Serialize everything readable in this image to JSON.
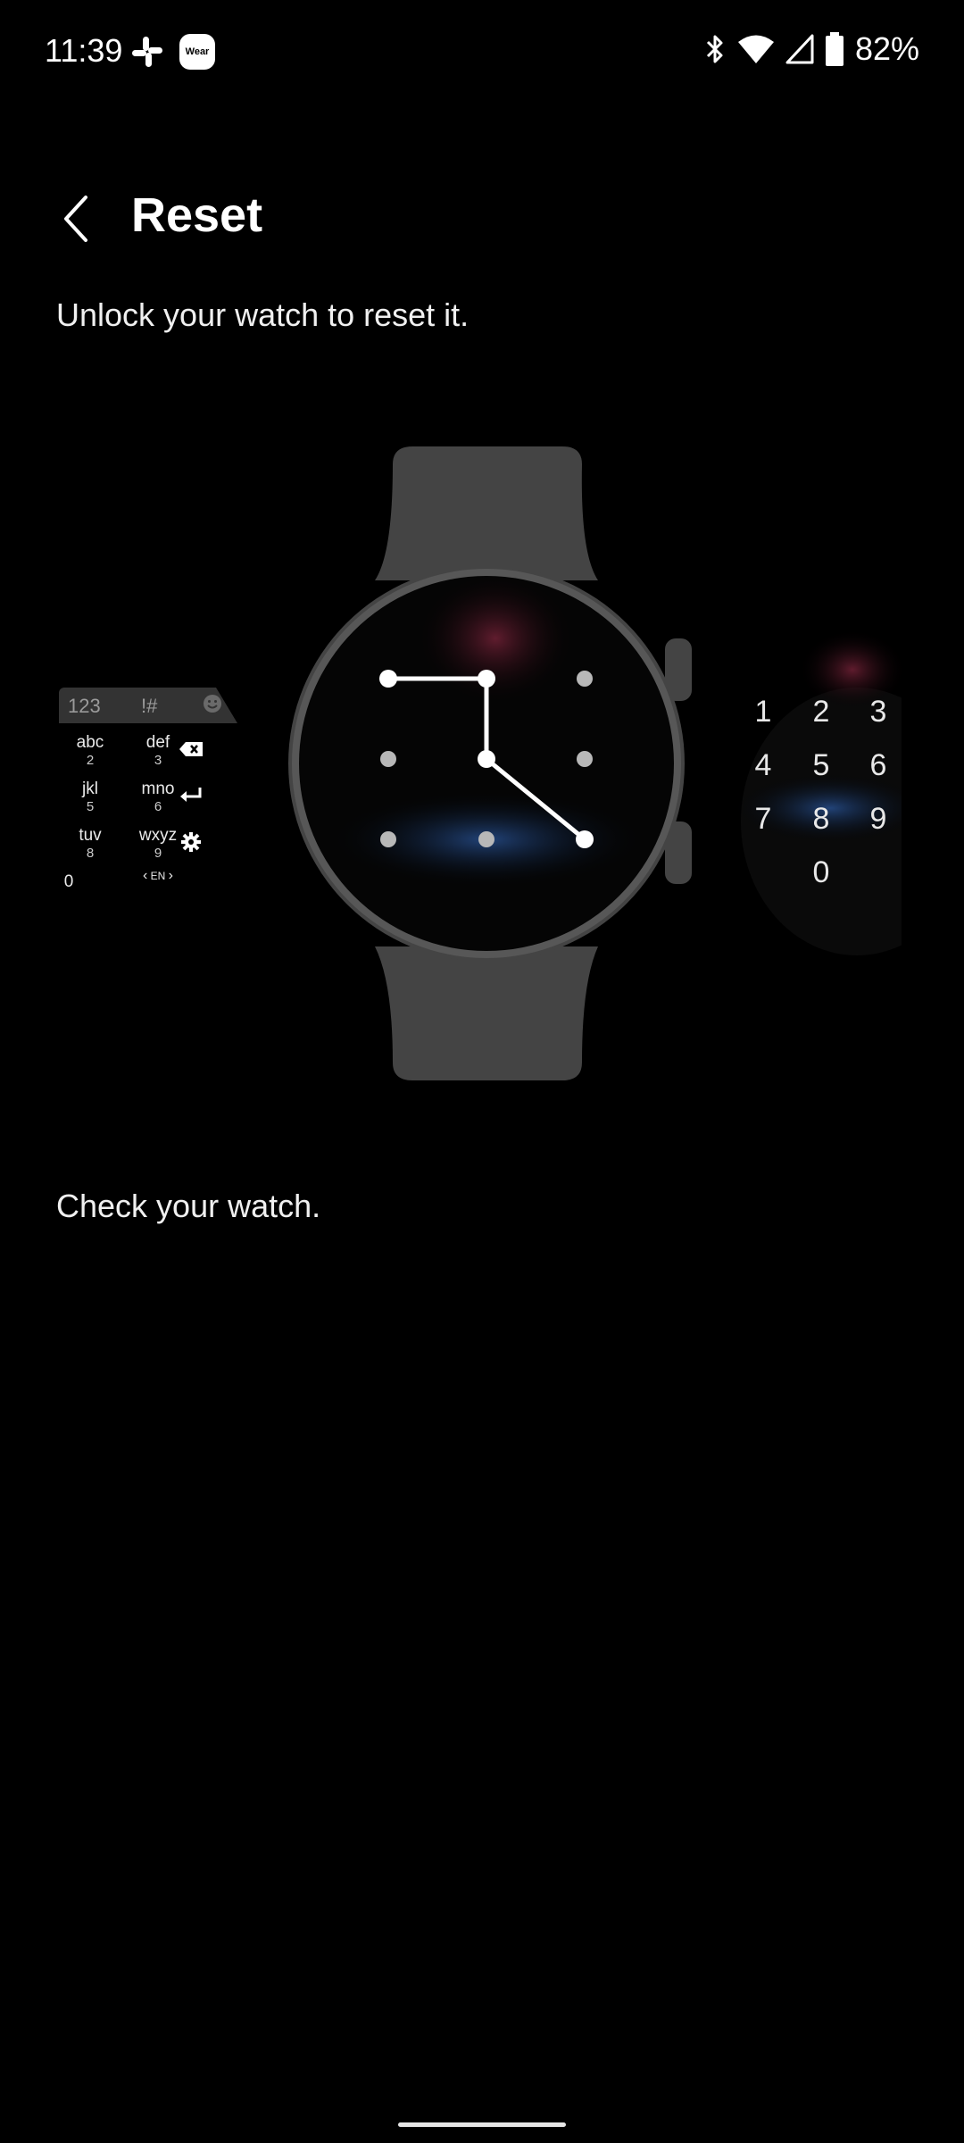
{
  "status_bar": {
    "time": "11:39",
    "wear_badge": "Wear",
    "battery": "82%",
    "icons": [
      "slack-icon",
      "wear-app-icon",
      "bluetooth-icon",
      "wifi-icon",
      "signal-icon",
      "battery-icon"
    ]
  },
  "header": {
    "title": "Reset",
    "back_icon": "chevron-left-icon"
  },
  "subtitle": "Unlock your watch to reset it.",
  "footer_text": "Check your watch.",
  "keyboard": {
    "top_keys": [
      "123",
      "!#"
    ],
    "keys": [
      {
        "letters": "abc",
        "num": "2"
      },
      {
        "letters": "def",
        "num": "3"
      },
      {
        "letters": "jkl",
        "num": "5"
      },
      {
        "letters": "mno",
        "num": "6"
      },
      {
        "letters": "tuv",
        "num": "8"
      },
      {
        "letters": "wxyz",
        "num": "9"
      }
    ],
    "zero": "0",
    "lang": "EN"
  },
  "pinpad": {
    "digits": [
      "1",
      "2",
      "3",
      "4",
      "5",
      "6",
      "7",
      "8",
      "9",
      "0"
    ]
  },
  "colors": {
    "watch_body": "#444444",
    "bezel": "#575757",
    "glow_red": "#5a1a2a",
    "glow_blue": "#1e3a6a"
  }
}
